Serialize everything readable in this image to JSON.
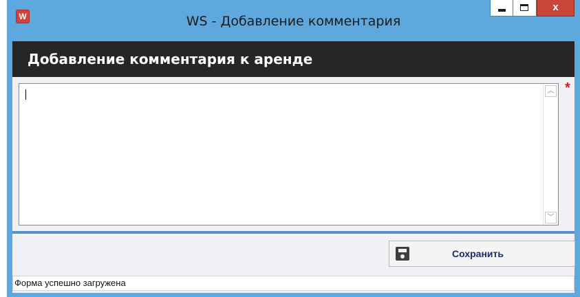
{
  "window": {
    "title": "WS - Добавление комментария",
    "icon": "app-logo-icon",
    "icon_letter": "W",
    "minimize_icon": "minimize-icon",
    "maximize_icon": "maximize-icon",
    "close_label": "x",
    "colors": {
      "frame": "#5fa8de",
      "close": "#c7463a"
    }
  },
  "header": {
    "title": "Добавление комментария к аренде",
    "background": "#262626"
  },
  "form": {
    "comment": {
      "value": "",
      "required_mark": "*",
      "scroll_up_icon": "chevron-up-icon",
      "scroll_down_icon": "chevron-down-icon",
      "scroll_up_glyph": "︿",
      "scroll_down_glyph": "﹀"
    },
    "save_button": {
      "label": "Сохранить",
      "icon": "floppy-disk-icon"
    }
  },
  "status_bar": {
    "text": "Форма успешно загружена"
  }
}
